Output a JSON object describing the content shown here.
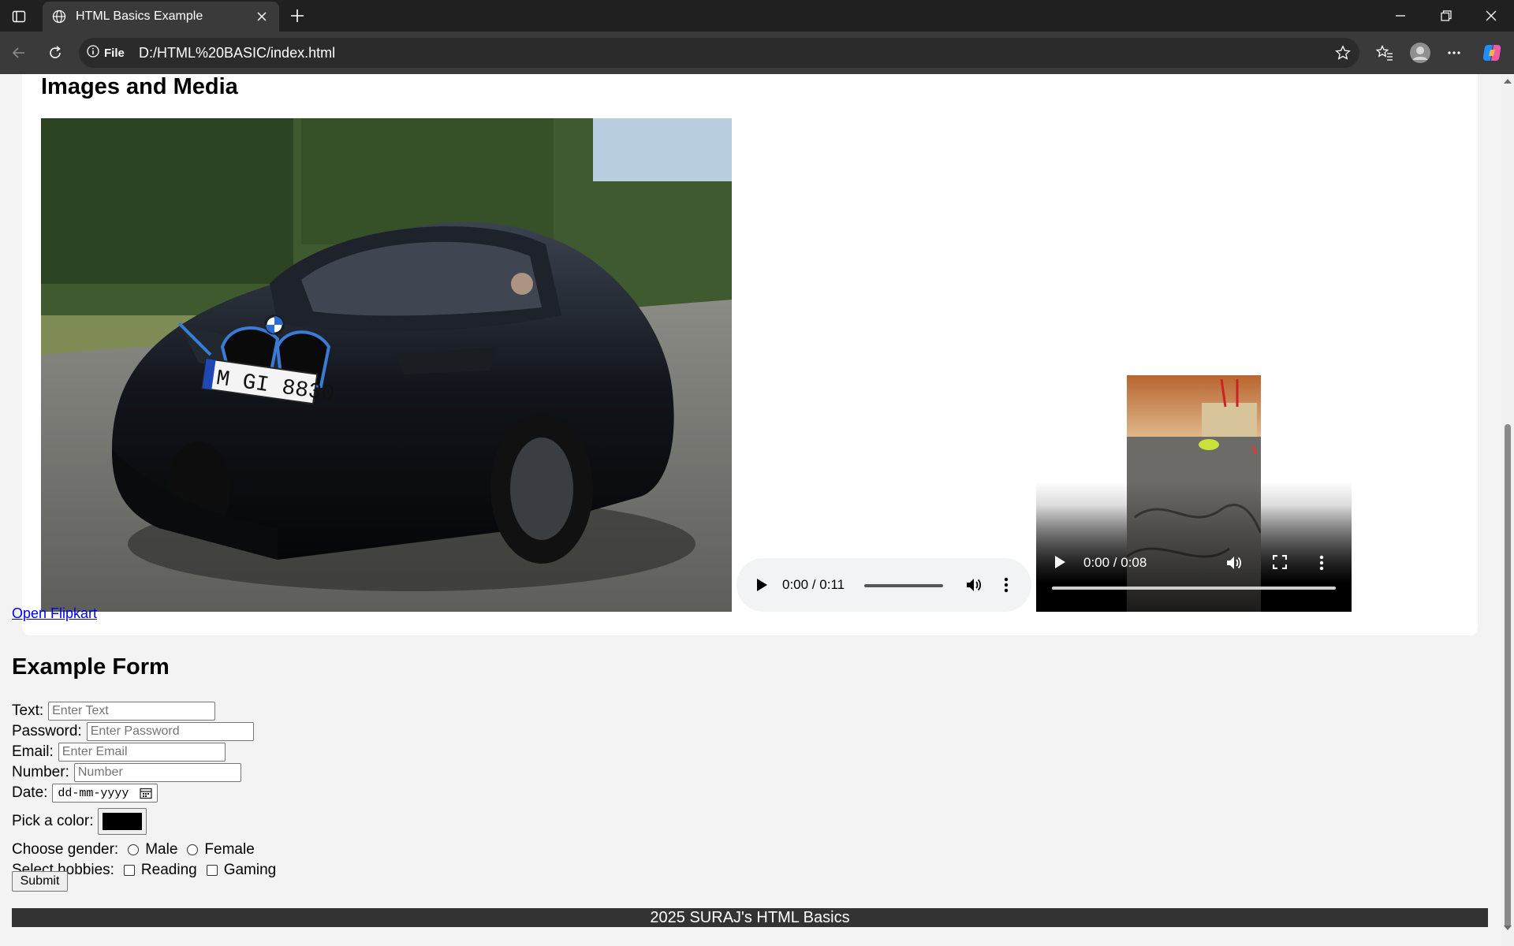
{
  "browser": {
    "tab_title": "HTML Basics Example",
    "omnibox": {
      "scheme_label": "File",
      "url": "D:/HTML%20BASIC/index.html"
    }
  },
  "page": {
    "media_section": {
      "title": "Images and Media",
      "image_alt": "BMW i8",
      "audio": {
        "time": "0:00 / 0:11"
      },
      "video": {
        "time": "0:00 / 0:08"
      },
      "link_text": "Open Flipkart"
    },
    "form": {
      "title": "Example Form",
      "text_label": "Text:",
      "text_placeholder": "Enter Text",
      "password_label": "Password:",
      "password_placeholder": "Enter Password",
      "email_label": "Email:",
      "email_placeholder": "Enter Email",
      "number_label": "Number:",
      "number_placeholder": "Number",
      "date_label": "Date:",
      "date_placeholder": "dd-mm-yyyy",
      "color_label": "Pick a color:",
      "color_value": "#000000",
      "gender_label": "Choose gender:",
      "gender_options": [
        "Male",
        "Female"
      ],
      "hobbies_label": "Select hobbies:",
      "hobby_options": [
        "Reading",
        "Gaming"
      ],
      "submit_label": "Submit"
    },
    "footer": "2025 SURAJ's HTML Basics"
  },
  "colors": {
    "chrome_dark": "#202020",
    "toolbar": "#3a3a3a",
    "page_bg": "#f3f3f3",
    "link": "#0000ee",
    "footer_bg": "#333333"
  }
}
